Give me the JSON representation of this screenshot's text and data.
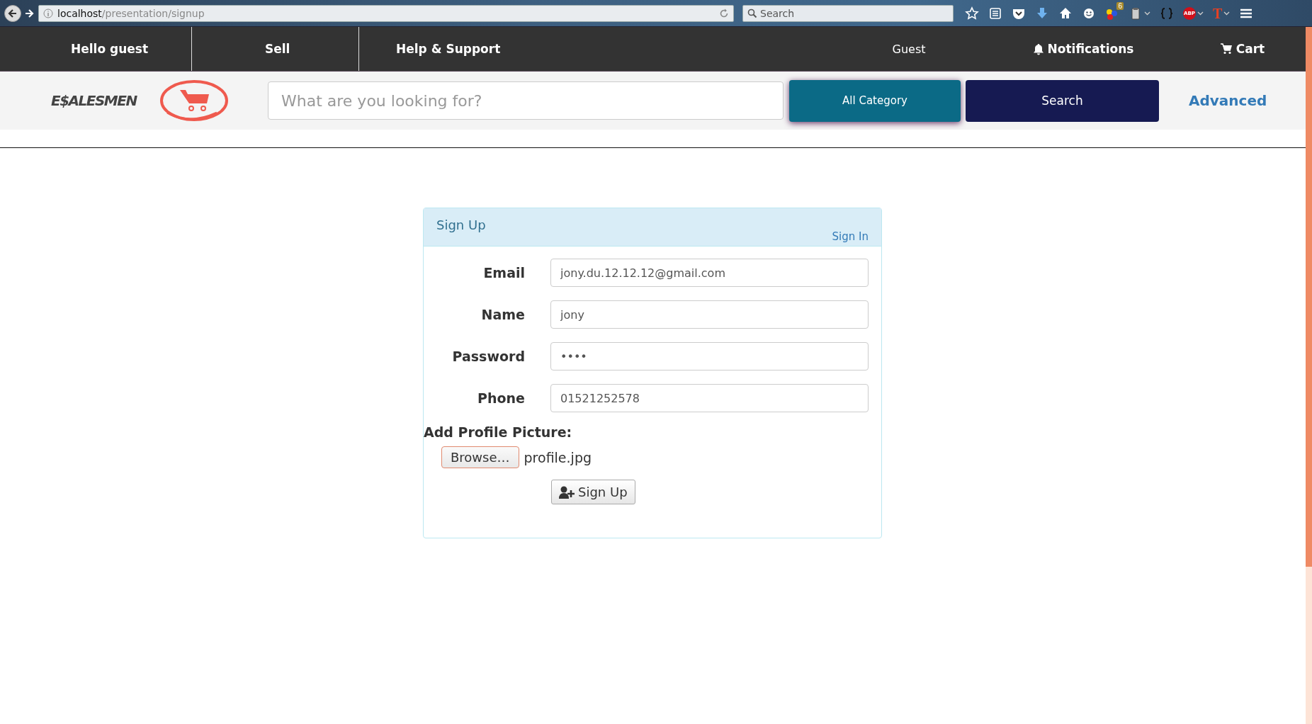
{
  "browser": {
    "address": "localhost/presentation/signup",
    "search_placeholder": "Search",
    "toolbar_icons": [
      {
        "kind": "star"
      },
      {
        "kind": "reader"
      },
      {
        "kind": "pocket"
      },
      {
        "kind": "download"
      },
      {
        "kind": "home"
      },
      {
        "kind": "smiley"
      },
      {
        "kind": "colors",
        "badge": "6"
      },
      {
        "kind": "clipboard",
        "menu": true
      },
      {
        "kind": "braces"
      },
      {
        "kind": "adblock",
        "text": "ABP",
        "menu": true
      },
      {
        "kind": "letter",
        "text": "T",
        "menu": true
      },
      {
        "kind": "hamburger"
      }
    ]
  },
  "nav": {
    "left": [
      {
        "label": "Hello guest"
      },
      {
        "label": "Sell"
      },
      {
        "label": "Help & Support"
      }
    ],
    "right": [
      {
        "label": "Guest",
        "kind": "text"
      },
      {
        "label": "Notifications",
        "kind": "bell"
      },
      {
        "label": "Cart",
        "kind": "cart"
      }
    ]
  },
  "header": {
    "logo_text": "E$ALESMEN",
    "search": {
      "placeholder": "What are you looking for?"
    },
    "category_button": "All Category",
    "search_button": "Search",
    "advanced_link": "Advanced"
  },
  "signup": {
    "title": "Sign Up",
    "signin_link": "Sign In",
    "fields": [
      {
        "label": "Email",
        "value": "jony.du.12.12.12@gmail.com"
      },
      {
        "label": "Name",
        "value": "jony"
      },
      {
        "label": "Password",
        "value": "••••"
      },
      {
        "label": "Phone",
        "value": "01521252578"
      }
    ],
    "picture_label": "Add Profile Picture:",
    "browse_button": "Browse…",
    "file_name": "profile.jpg",
    "submit_button": "Sign Up"
  }
}
